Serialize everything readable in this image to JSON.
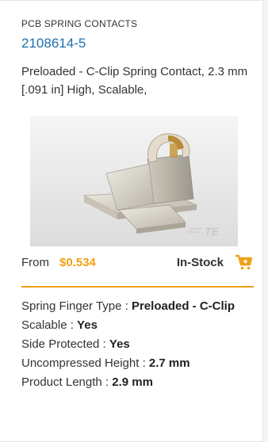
{
  "card": {
    "category": "PCB SPRING CONTACTS",
    "part_number": "2108614-5",
    "description": "Preloaded - C-Clip Spring Contact, 2.3 mm [.091 in] High, Scalable,",
    "image": {
      "alt": "C-Clip spring contact product photo",
      "watermark": "TE"
    },
    "price": {
      "from_label": "From",
      "value": "$0.534",
      "stock_status": "In-Stock"
    },
    "specs": [
      {
        "label": "Spring Finger Type : ",
        "value": "Preloaded - C-Clip"
      },
      {
        "label": "Scalable : ",
        "value": "Yes"
      },
      {
        "label": "Side Protected : ",
        "value": "Yes"
      },
      {
        "label": "Uncompressed Height : ",
        "value": "2.7 mm"
      },
      {
        "label": "Product Length : ",
        "value": "2.9 mm"
      }
    ],
    "colors": {
      "accent": "#f0a014",
      "link": "#1f6fae"
    }
  }
}
